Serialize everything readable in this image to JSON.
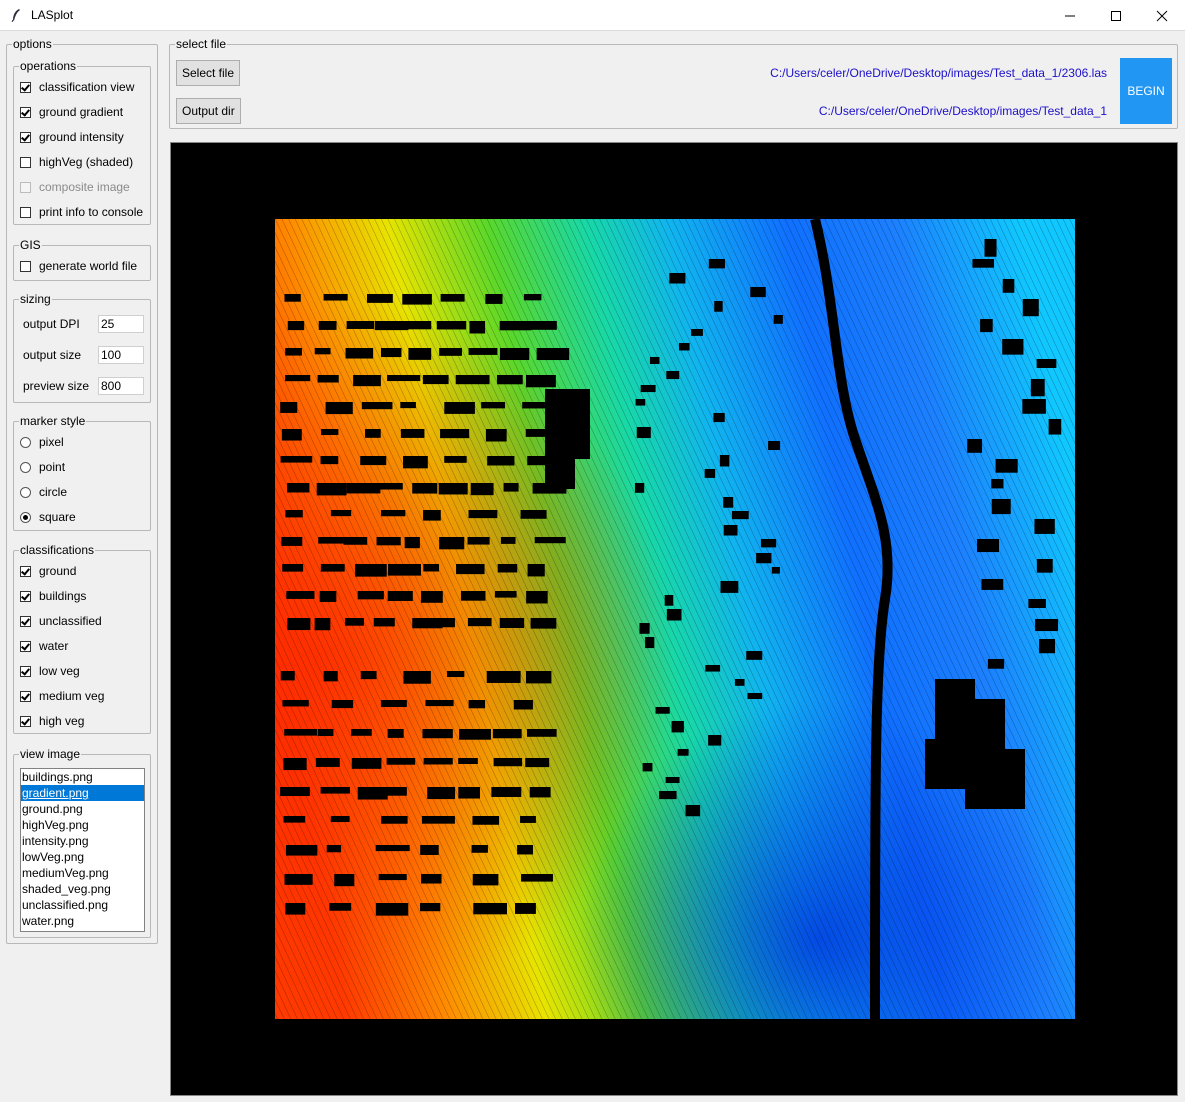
{
  "window": {
    "title": "LASplot"
  },
  "options": {
    "title": "options",
    "operations": {
      "title": "operations",
      "items": [
        {
          "label": "classification view",
          "checked": true,
          "enabled": true
        },
        {
          "label": "ground gradient",
          "checked": true,
          "enabled": true
        },
        {
          "label": "ground intensity",
          "checked": true,
          "enabled": true
        },
        {
          "label": "highVeg (shaded)",
          "checked": false,
          "enabled": true
        },
        {
          "label": "composite image",
          "checked": false,
          "enabled": false
        },
        {
          "label": "print info to console",
          "checked": false,
          "enabled": true
        }
      ]
    },
    "gis": {
      "title": "GIS",
      "world_file_label": "generate world file",
      "world_file_checked": false
    },
    "sizing": {
      "title": "sizing",
      "dpi_label": "output DPI",
      "dpi_value": "25",
      "size_label": "output size",
      "size_value": "100",
      "preview_label": "preview size",
      "preview_value": "800"
    },
    "marker_style": {
      "title": "marker style",
      "options": [
        "pixel",
        "point",
        "circle",
        "square"
      ],
      "selected": "square"
    },
    "classifications": {
      "title": "classifications",
      "items": [
        {
          "label": "ground",
          "checked": true
        },
        {
          "label": "buildings",
          "checked": true
        },
        {
          "label": "unclassified",
          "checked": true
        },
        {
          "label": "water",
          "checked": true
        },
        {
          "label": "low veg",
          "checked": true
        },
        {
          "label": "medium veg",
          "checked": true
        },
        {
          "label": "high veg",
          "checked": true
        }
      ]
    },
    "view_image": {
      "title": "view image",
      "files": [
        "buildings.png",
        "gradient.png",
        "ground.png",
        "highVeg.png",
        "intensity.png",
        "lowVeg.png",
        "mediumVeg.png",
        "shaded_veg.png",
        "unclassified.png",
        "water.png"
      ],
      "selected": "gradient.png"
    }
  },
  "select_file": {
    "title": "select file",
    "select_button": "Select file",
    "output_button": "Output dir",
    "file_path": "C:/Users/celer/OneDrive/Desktop/images/Test_data_1/2306.las",
    "output_path": "C:/Users/celer/OneDrive/Desktop/images/Test_data_1",
    "begin_button": "BEGIN"
  },
  "colors": {
    "accent": "#2196f3",
    "path_text": "#1c10c8",
    "selection": "#0078d7"
  }
}
